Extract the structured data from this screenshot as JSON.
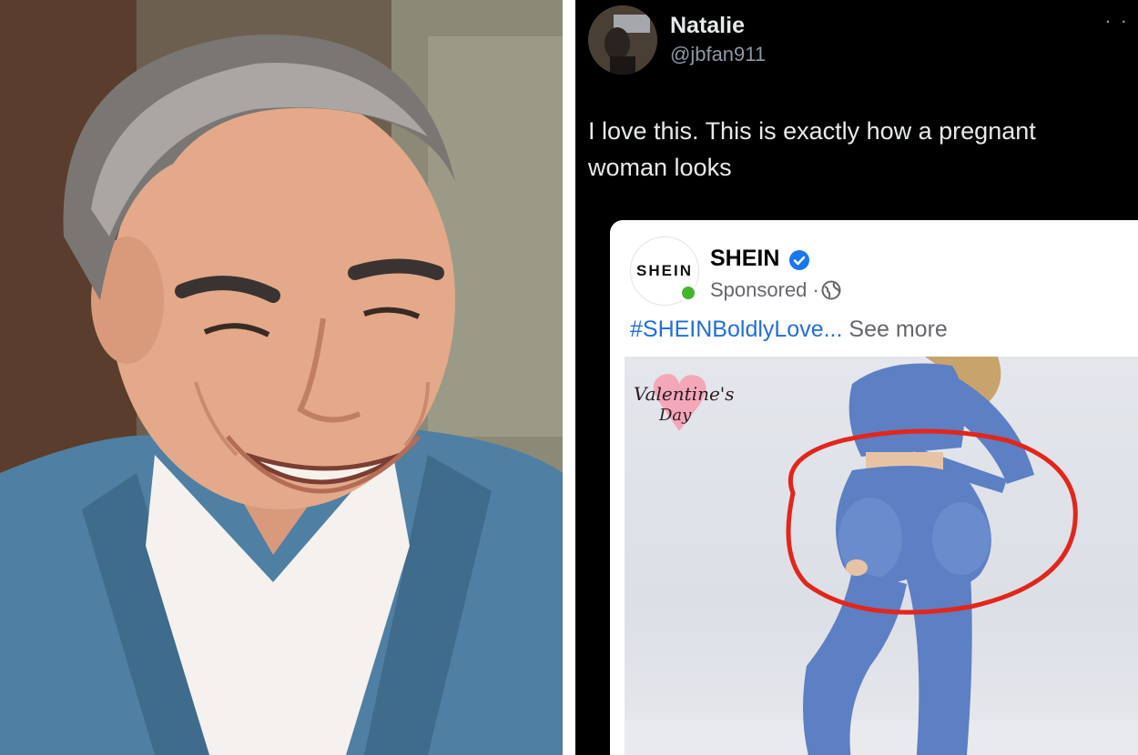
{
  "tweet": {
    "author_name": "Natalie",
    "author_handle": "@jbfan911",
    "text": "I love this. This is exactly how a pregnant woman looks",
    "more_icon": "ellipsis-icon"
  },
  "ad": {
    "brand_logo_text": "SHEIN",
    "brand_name": "SHEIN",
    "verified_icon": "verified-badge-icon",
    "sponsored_label": "Sponsored ·",
    "globe_icon": "globe-icon",
    "hashtag": "#SHEINBoldlyLove...",
    "see_more": "See more",
    "sticker_text_line1": "Valentine's",
    "sticker_text_line2": "Day"
  },
  "colors": {
    "tweet_background": "#000000",
    "hashtag": "#216fdb",
    "verified": "#1877f2",
    "online": "#42b72a",
    "annotation_circle": "#e2261b",
    "leggings": "#5d7fc4"
  }
}
